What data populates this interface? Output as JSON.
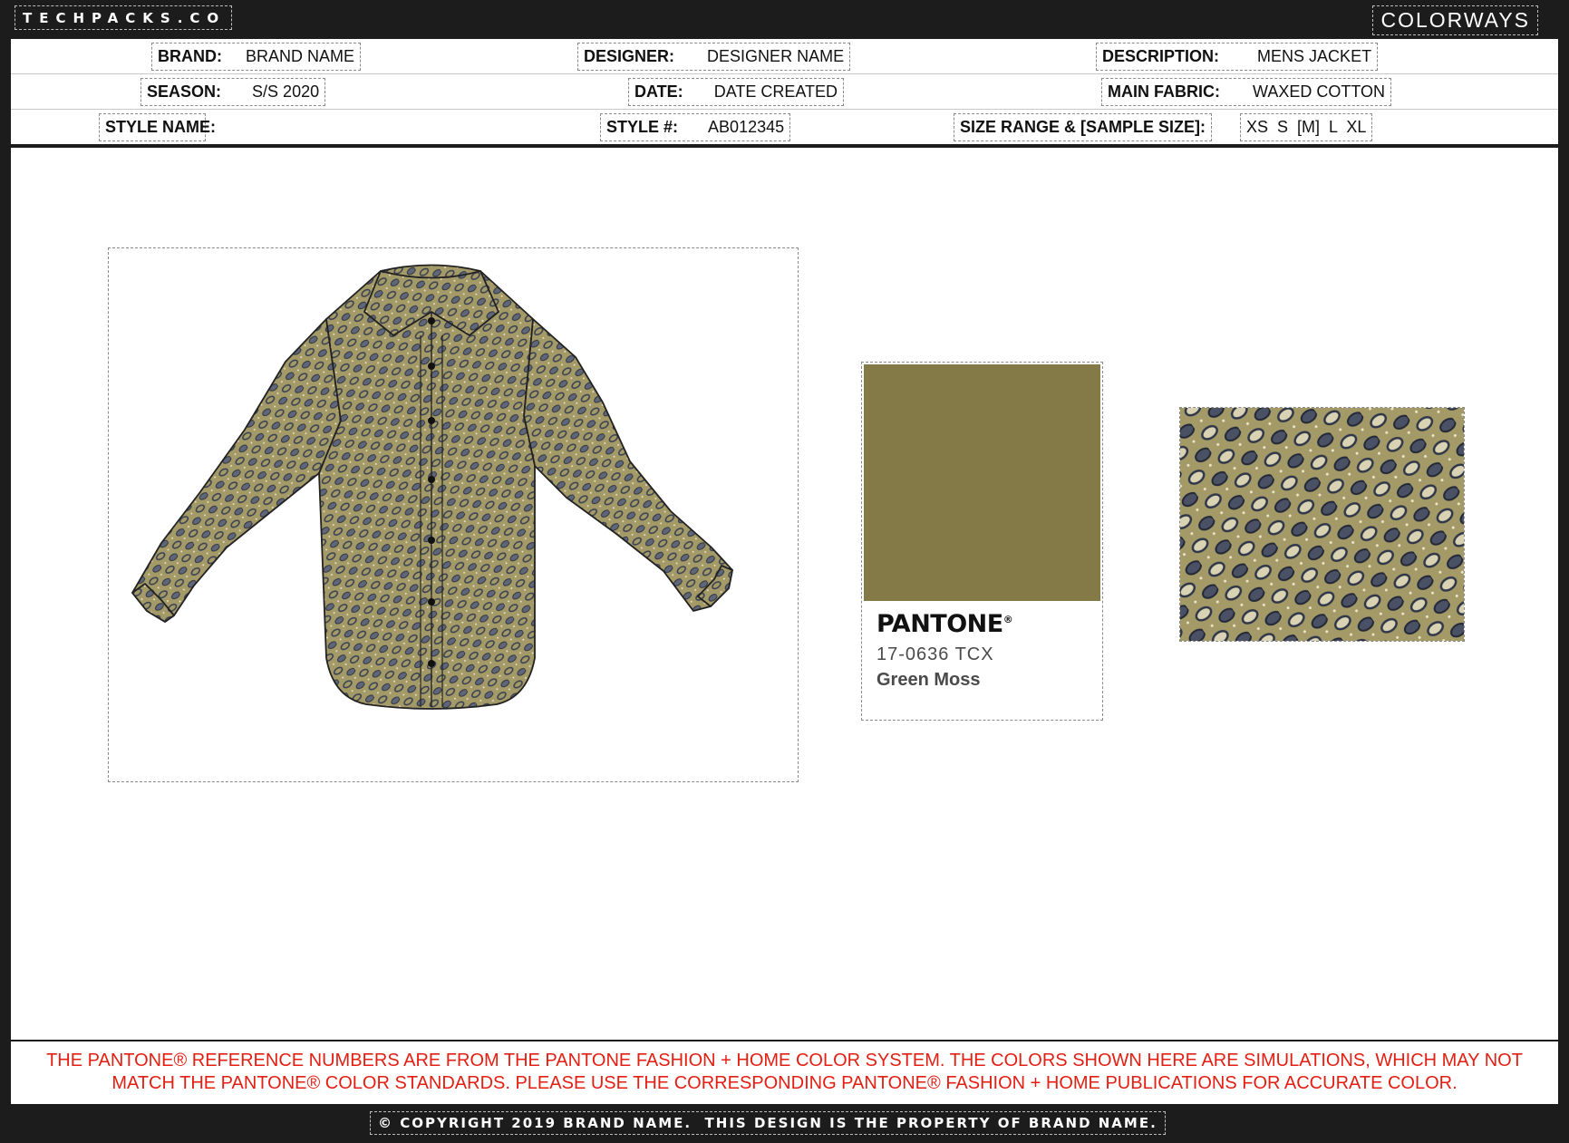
{
  "header": {
    "logo": "TECHPACKS.CO",
    "page_title": "COLORWAYS"
  },
  "spec": {
    "brand_label": "BRAND:",
    "brand_value": "BRAND NAME",
    "designer_label": "DESIGNER:",
    "designer_value": "DESIGNER NAME",
    "description_label": "DESCRIPTION:",
    "description_value": "MENS JACKET",
    "season_label": "SEASON:",
    "season_value": "S/S 2020",
    "date_label": "DATE:",
    "date_value": "DATE CREATED",
    "main_fabric_label": "MAIN FABRIC:",
    "main_fabric_value": "WAXED COTTON",
    "style_name_label": "STYLE NAME:",
    "style_name_value": "",
    "style_number_label": "STYLE #:",
    "style_number_value": "AB012345",
    "size_range_label": "SIZE RANGE & [SAMPLE SIZE]:",
    "size_range_value": "XS  S  [M]  L  XL"
  },
  "colorway": {
    "pantone_brand": "PANTONE",
    "pantone_code": "17-0636 TCX",
    "pantone_name": "Green Moss",
    "swatch_color": "#847a47",
    "fabric_base_color": "#a39a68",
    "print_color": "#3a4152",
    "sketch_icon": "long-sleeve-shirt-sketch"
  },
  "disclaimer": {
    "line1": "THE PANTONE® REFERENCE NUMBERS ARE FROM THE PANTONE FASHION + HOME COLOR SYSTEM. THE COLORS SHOWN HERE ARE SIMULATIONS, WHICH MAY NOT",
    "line2": "MATCH THE PANTONE® COLOR STANDARDS. PLEASE USE THE CORRESPONDING PANTONE® FASHION + HOME PUBLICATIONS FOR ACCURATE COLOR."
  },
  "footer": {
    "copyright": "© COPYRIGHT 2019 BRAND NAME.  THIS DESIGN IS THE PROPERTY OF BRAND NAME."
  }
}
